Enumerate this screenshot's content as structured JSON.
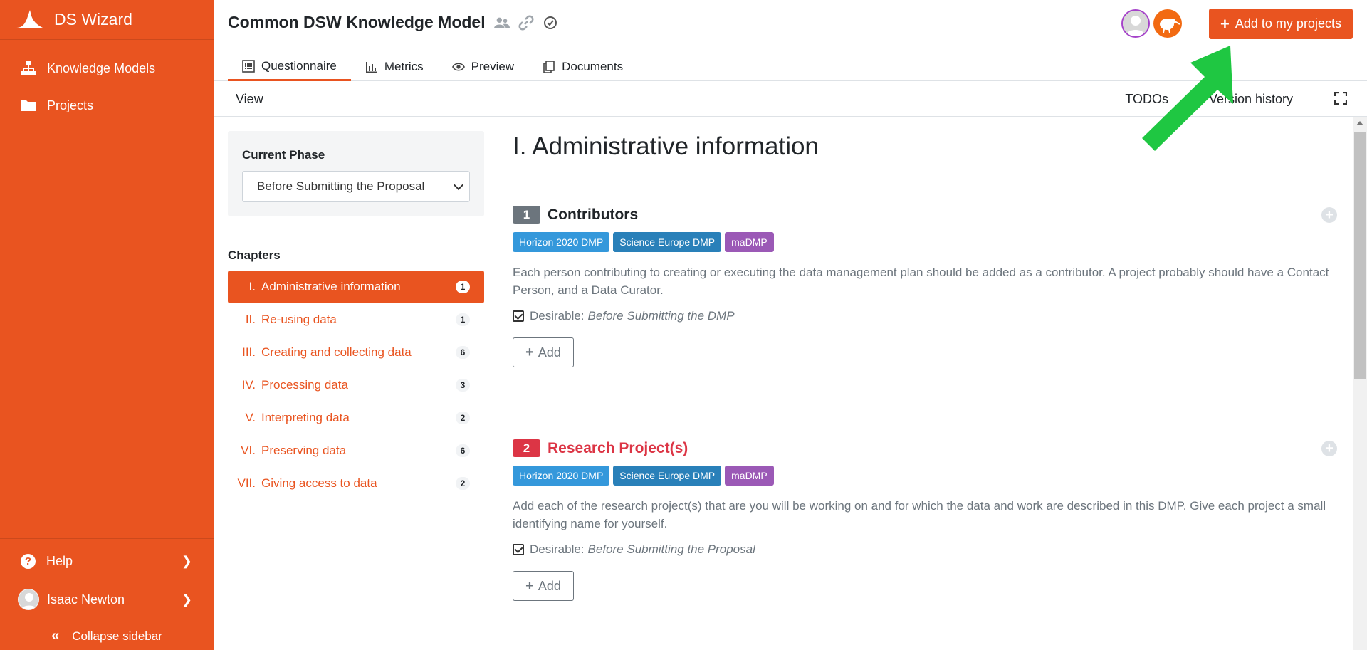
{
  "app": {
    "name": "DS Wizard"
  },
  "sidebar": {
    "items": [
      {
        "label": "Knowledge Models",
        "icon": "sitemap-icon"
      },
      {
        "label": "Projects",
        "icon": "folder-icon"
      }
    ],
    "help_label": "Help",
    "user_name": "Isaac Newton",
    "collapse_label": "Collapse sidebar"
  },
  "header": {
    "title": "Common DSW Knowledge Model",
    "add_button_label": "Add to my projects",
    "tabs": [
      {
        "label": "Questionnaire",
        "active": true
      },
      {
        "label": "Metrics"
      },
      {
        "label": "Preview"
      },
      {
        "label": "Documents"
      }
    ]
  },
  "viewbar": {
    "view_label": "View",
    "todos_label": "TODOs",
    "version_history_label": "Version history"
  },
  "phase": {
    "label": "Current Phase",
    "selected": "Before Submitting the Proposal"
  },
  "chapters": {
    "label": "Chapters",
    "items": [
      {
        "num": "I.",
        "label": "Administrative information",
        "count": "1",
        "active": true
      },
      {
        "num": "II.",
        "label": "Re-using data",
        "count": "1"
      },
      {
        "num": "III.",
        "label": "Creating and collecting data",
        "count": "6"
      },
      {
        "num": "IV.",
        "label": "Processing data",
        "count": "3"
      },
      {
        "num": "V.",
        "label": "Interpreting data",
        "count": "2"
      },
      {
        "num": "VI.",
        "label": "Preserving data",
        "count": "6"
      },
      {
        "num": "VII.",
        "label": "Giving access to data",
        "count": "2"
      }
    ]
  },
  "main": {
    "chapter_title": "I. Administrative information",
    "questions": [
      {
        "number": "1",
        "title": "Contributors",
        "tags": [
          "Horizon 2020 DMP",
          "Science Europe DMP",
          "maDMP"
        ],
        "text": "Each person contributing to creating or executing the data management plan should be added as a contributor. A project probably should have a Contact Person, and a Data Curator.",
        "desirable_label": "Desirable:",
        "desirable_value": "Before Submitting the DMP",
        "add_label": "Add"
      },
      {
        "number": "2",
        "title": "Research Project(s)",
        "tags": [
          "Horizon 2020 DMP",
          "Science Europe DMP",
          "maDMP"
        ],
        "text": "Add each of the research project(s) that are you will be working on and for which the data and work are described in this DMP. Give each project a small identifying name for yourself.",
        "desirable_label": "Desirable:",
        "desirable_value": "Before Submitting the Proposal",
        "add_label": "Add"
      }
    ]
  },
  "colors": {
    "brand": "#e95420",
    "tag_h2020": "#3498db",
    "tag_science_europe": "#2980b9",
    "tag_madmp": "#9b59b6",
    "required": "#dc3545",
    "arrow": "#1fc742"
  }
}
